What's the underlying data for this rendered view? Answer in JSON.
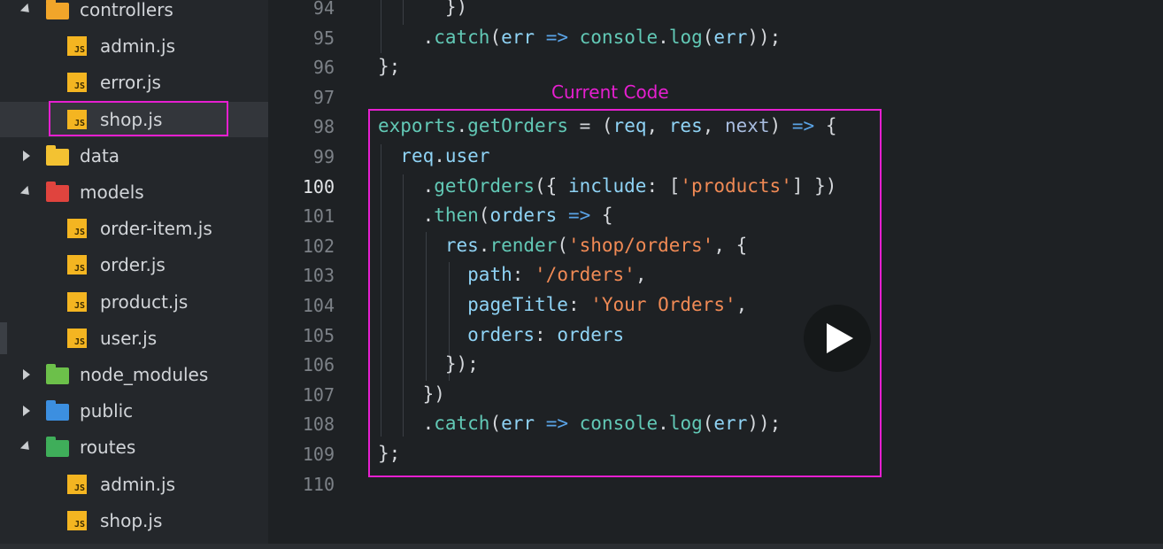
{
  "sidebar": {
    "items": [
      {
        "label": "controllers",
        "kind": "folder",
        "state": "open",
        "icon": "controllers-folder-icon",
        "color": "#f1a52a"
      },
      {
        "label": "admin.js",
        "kind": "file",
        "icon": "js-file-icon"
      },
      {
        "label": "error.js",
        "kind": "file",
        "icon": "js-file-icon"
      },
      {
        "label": "shop.js",
        "kind": "file",
        "icon": "js-file-icon",
        "selected": true
      },
      {
        "label": "data",
        "kind": "folder",
        "state": "closed",
        "icon": "data-folder-icon",
        "color": "#f3c232"
      },
      {
        "label": "models",
        "kind": "folder",
        "state": "open",
        "icon": "models-folder-icon",
        "color": "#e0443e"
      },
      {
        "label": "order-item.js",
        "kind": "file",
        "icon": "js-file-icon"
      },
      {
        "label": "order.js",
        "kind": "file",
        "icon": "js-file-icon"
      },
      {
        "label": "product.js",
        "kind": "file",
        "icon": "js-file-icon"
      },
      {
        "label": "user.js",
        "kind": "file",
        "icon": "js-file-icon"
      },
      {
        "label": "node_modules",
        "kind": "folder",
        "state": "closed",
        "icon": "node-modules-folder-icon",
        "color": "#6cc04a"
      },
      {
        "label": "public",
        "kind": "folder",
        "state": "closed",
        "icon": "public-folder-icon",
        "color": "#3c8fe0"
      },
      {
        "label": "routes",
        "kind": "folder",
        "state": "open",
        "icon": "routes-folder-icon",
        "color": "#3fae5a"
      },
      {
        "label": "admin.js",
        "kind": "file",
        "icon": "js-file-icon"
      },
      {
        "label": "shop.js",
        "kind": "file",
        "icon": "js-file-icon"
      }
    ],
    "js_badge": "JS"
  },
  "annotation": {
    "label": "Current Code",
    "color": "#e61fd0"
  },
  "editor": {
    "active_line": "100",
    "lines": [
      {
        "n": "94",
        "tokens": [
          [
            "p",
            "      })"
          ]
        ]
      },
      {
        "n": "95",
        "tokens": [
          [
            "p",
            "    ."
          ],
          [
            "f",
            "catch"
          ],
          [
            "p",
            "("
          ],
          [
            "v",
            "err"
          ],
          [
            "p",
            " "
          ],
          [
            "o",
            "=>"
          ],
          [
            "p",
            " "
          ],
          [
            "f",
            "console"
          ],
          [
            "p",
            "."
          ],
          [
            "f",
            "log"
          ],
          [
            "p",
            "("
          ],
          [
            "v",
            "err"
          ],
          [
            "p",
            "));"
          ]
        ]
      },
      {
        "n": "96",
        "tokens": [
          [
            "p",
            "};"
          ]
        ]
      },
      {
        "n": "97",
        "tokens": []
      },
      {
        "n": "98",
        "tokens": [
          [
            "f",
            "exports"
          ],
          [
            "p",
            "."
          ],
          [
            "f",
            "getOrders"
          ],
          [
            "p",
            " = ("
          ],
          [
            "v",
            "req"
          ],
          [
            "p",
            ", "
          ],
          [
            "v",
            "res"
          ],
          [
            "p",
            ", "
          ],
          [
            "a",
            "next"
          ],
          [
            "p",
            ") "
          ],
          [
            "o",
            "=>"
          ],
          [
            "p",
            " {"
          ]
        ]
      },
      {
        "n": "99",
        "tokens": [
          [
            "p",
            "  "
          ],
          [
            "v",
            "req"
          ],
          [
            "p",
            "."
          ],
          [
            "v",
            "user"
          ]
        ]
      },
      {
        "n": "100",
        "tokens": [
          [
            "p",
            "    ."
          ],
          [
            "f",
            "getOrders"
          ],
          [
            "p",
            "({ "
          ],
          [
            "v",
            "include"
          ],
          [
            "p",
            ": ["
          ],
          [
            "s",
            "'products'"
          ],
          [
            "p",
            "] })"
          ]
        ]
      },
      {
        "n": "101",
        "tokens": [
          [
            "p",
            "    ."
          ],
          [
            "f",
            "then"
          ],
          [
            "p",
            "("
          ],
          [
            "v",
            "orders"
          ],
          [
            "p",
            " "
          ],
          [
            "o",
            "=>"
          ],
          [
            "p",
            " {"
          ]
        ]
      },
      {
        "n": "102",
        "tokens": [
          [
            "p",
            "      "
          ],
          [
            "v",
            "res"
          ],
          [
            "p",
            "."
          ],
          [
            "f",
            "render"
          ],
          [
            "p",
            "("
          ],
          [
            "s",
            "'shop/orders'"
          ],
          [
            "p",
            ", {"
          ]
        ]
      },
      {
        "n": "103",
        "tokens": [
          [
            "p",
            "        "
          ],
          [
            "v",
            "path"
          ],
          [
            "p",
            ": "
          ],
          [
            "s",
            "'/orders'"
          ],
          [
            "p",
            ","
          ]
        ]
      },
      {
        "n": "104",
        "tokens": [
          [
            "p",
            "        "
          ],
          [
            "v",
            "pageTitle"
          ],
          [
            "p",
            ": "
          ],
          [
            "s",
            "'Your Orders'"
          ],
          [
            "p",
            ","
          ]
        ]
      },
      {
        "n": "105",
        "tokens": [
          [
            "p",
            "        "
          ],
          [
            "v",
            "orders"
          ],
          [
            "p",
            ": "
          ],
          [
            "v",
            "orders"
          ]
        ]
      },
      {
        "n": "106",
        "tokens": [
          [
            "p",
            "      });"
          ]
        ]
      },
      {
        "n": "107",
        "tokens": [
          [
            "p",
            "    })"
          ]
        ]
      },
      {
        "n": "108",
        "tokens": [
          [
            "p",
            "    ."
          ],
          [
            "f",
            "catch"
          ],
          [
            "p",
            "("
          ],
          [
            "v",
            "err"
          ],
          [
            "p",
            " "
          ],
          [
            "o",
            "=>"
          ],
          [
            "p",
            " "
          ],
          [
            "f",
            "console"
          ],
          [
            "p",
            "."
          ],
          [
            "f",
            "log"
          ],
          [
            "p",
            "("
          ],
          [
            "v",
            "err"
          ],
          [
            "p",
            "));"
          ]
        ]
      },
      {
        "n": "109",
        "tokens": [
          [
            "p",
            "};"
          ]
        ]
      },
      {
        "n": "110",
        "tokens": []
      }
    ]
  },
  "video": {
    "icon": "play-icon"
  },
  "colors": {
    "accent": "#e61fd0",
    "background": "#1e2124",
    "sidebar": "#24272b"
  }
}
